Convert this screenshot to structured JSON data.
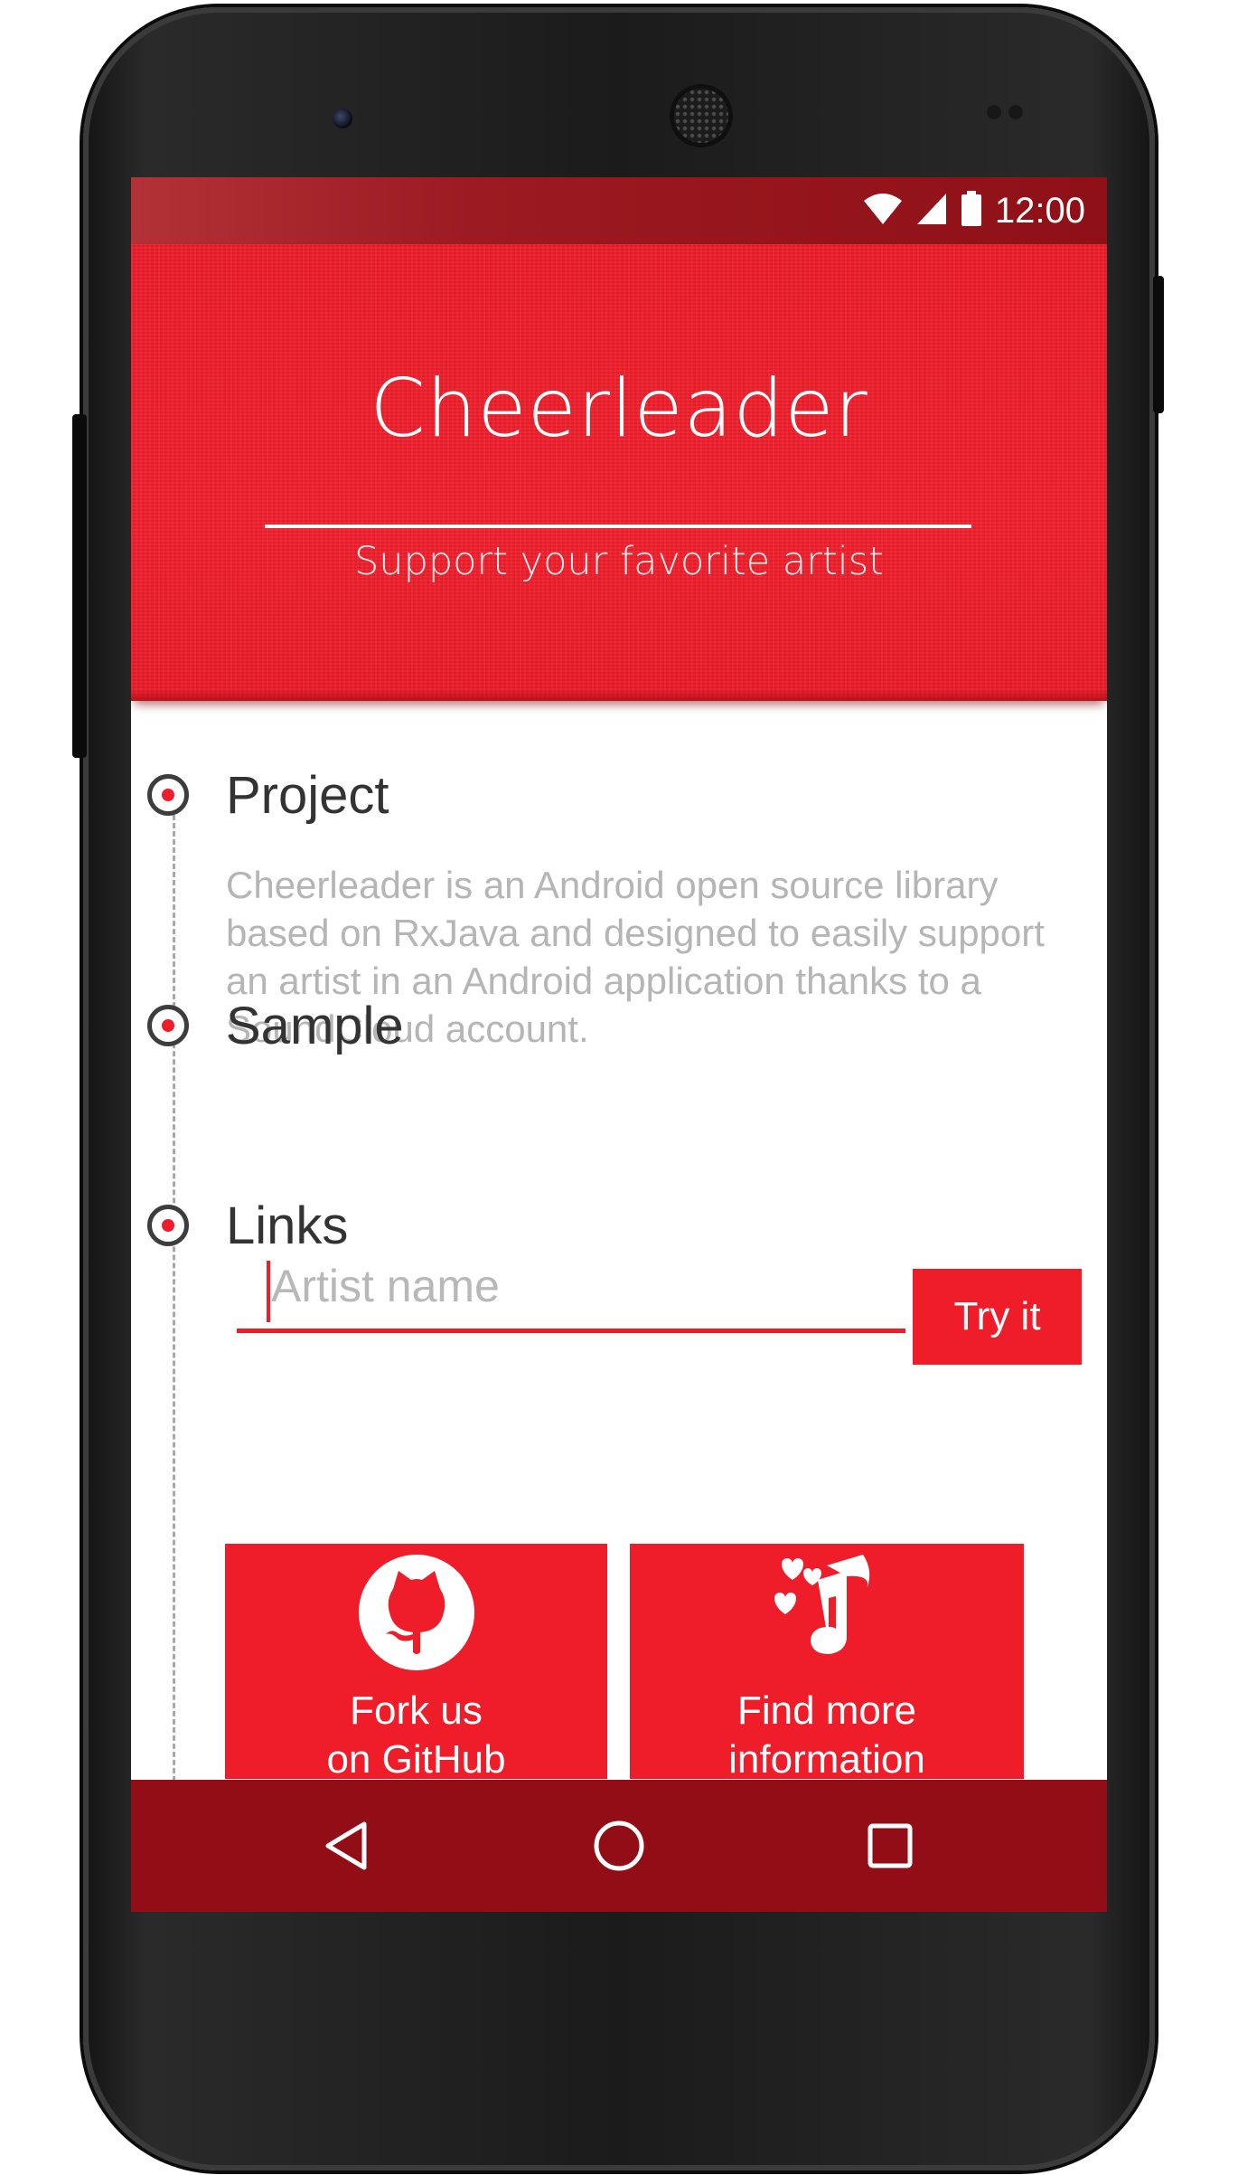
{
  "status_bar": {
    "time": "12:00",
    "icons": [
      "wifi-icon",
      "cell-signal-icon",
      "battery-icon"
    ]
  },
  "header": {
    "title": "Cheerleader",
    "subtitle": "Support your favorite artist"
  },
  "sections": {
    "project": {
      "title": "Project",
      "description": "Cheerleader is an Android open source library based on RxJava and designed to easily support an artist in an Android application thanks to a SoundCloud account."
    },
    "sample": {
      "title": "Sample",
      "input_value": "",
      "input_placeholder": "Artist name",
      "button_label": "Try it"
    },
    "links": {
      "title": "Links",
      "items": [
        {
          "line1": "Fork us",
          "line2": "on GitHub",
          "icon": "github-icon"
        },
        {
          "line1": "Find more",
          "line2": "information",
          "icon": "music-note-hearts-icon"
        }
      ]
    }
  },
  "nav_bar": {
    "icons": [
      "back-icon",
      "home-icon",
      "recents-icon"
    ]
  },
  "colors": {
    "accent": "#EF1D2A",
    "status_bar": "#9C1A21",
    "nav_bar": "#920D16",
    "text_dark": "#333333",
    "text_muted": "#B5B5B5"
  }
}
